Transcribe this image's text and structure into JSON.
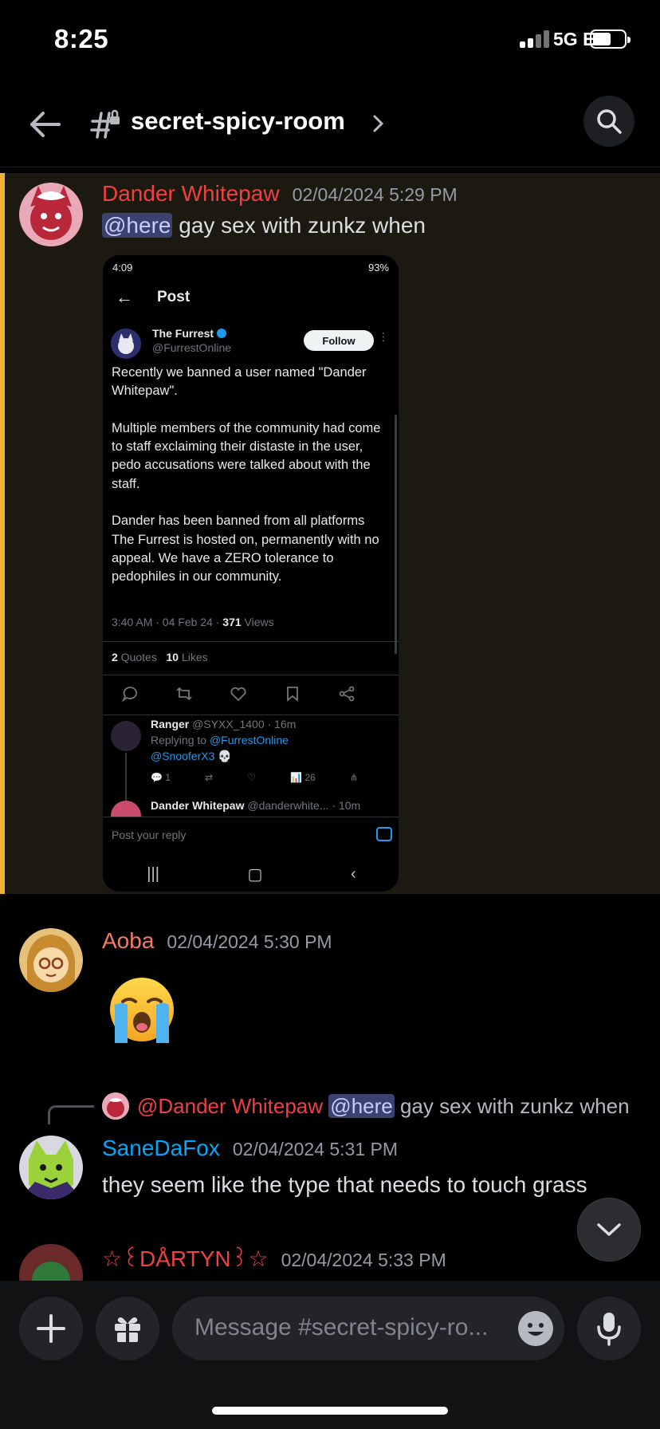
{
  "status": {
    "time": "8:25",
    "network": "5G E"
  },
  "header": {
    "channel": "secret-spicy-room"
  },
  "messages": [
    {
      "author": "Dander Whitepaw",
      "author_color": "#f23f43",
      "timestamp": "02/04/2024 5:29 PM",
      "mention": "@here",
      "text": " gay sex with zunkz when",
      "embed": {
        "status_time": "4:09",
        "status_right": "93%",
        "title": "Post",
        "account_name": "The Furrest",
        "account_handle": "@FurrestOnline",
        "follow_label": "Follow",
        "body": "Recently we banned a user named \"Dander Whitepaw\".\n\nMultiple members of the community had come to staff exclaiming their distaste in the user, pedo accusations were talked about with the staff.\n\nDander has been banned from all platforms The Furrest is hosted on, permanently with no appeal. We have a ZERO tolerance to pedophiles in our community.",
        "meta_time": "3:40 AM · 04 Feb 24 · ",
        "views_count": "371",
        "views_label": " Views",
        "quotes_count": "2",
        "quotes_label": " Quotes",
        "likes_count": "10",
        "likes_label": " Likes",
        "reply1_name": "Ranger",
        "reply1_meta": " @SYXX_1400 · 16m",
        "replying_to_label": "Replying to ",
        "replying_to": "@FurrestOnline",
        "reply1_text": "@SnooferX3 💀",
        "reply1_replies": "1",
        "reply1_views": "26",
        "reply2_name": "Dander Whitepaw",
        "reply2_meta": " @danderwhite... · 10m",
        "compose_placeholder": "Post your reply"
      }
    },
    {
      "author": "Aoba",
      "author_color": "#f47b67",
      "timestamp": "02/04/2024 5:30 PM",
      "emoji": "loudly-crying-face"
    },
    {
      "reply_to_author": "@Dander Whitepaw",
      "reply_mention": "@here",
      "reply_text": " gay sex with zunkz when",
      "author": "SaneDaFox",
      "author_color": "#00a8fc",
      "timestamp": "02/04/2024 5:31 PM",
      "text": "they seem like the type that needs to touch grass"
    },
    {
      "author": "☆꒰DÅRTYN꒱☆",
      "author_color": "#f23f43",
      "timestamp": "02/04/2024 5:33 PM"
    }
  ],
  "composer": {
    "placeholder": "Message #secret-spicy-ro..."
  }
}
